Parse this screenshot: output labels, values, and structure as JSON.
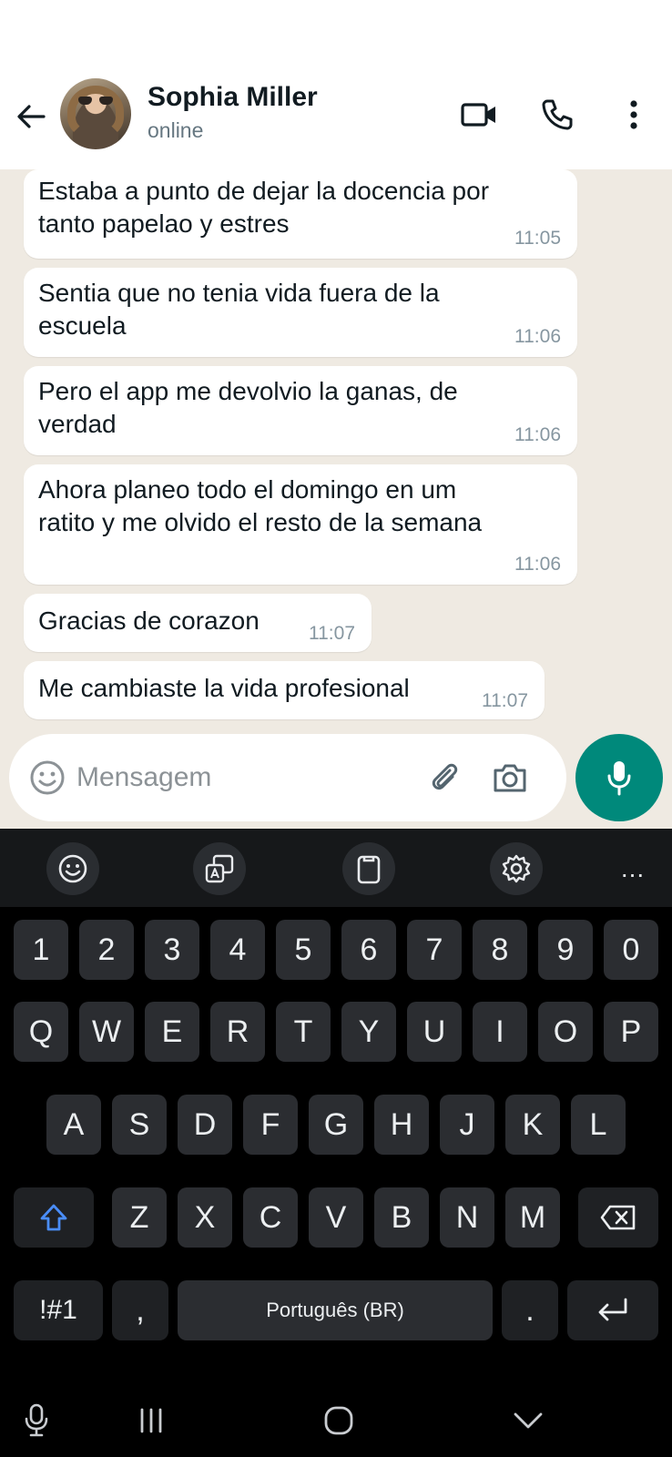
{
  "header": {
    "contact_name": "Sophia Miller",
    "contact_status": "online"
  },
  "messages": [
    {
      "text": "Estaba a punto de dejar la docencia por\ntanto papelao y estres",
      "time": "11:05"
    },
    {
      "text": "Sentia que no tenia vida fuera de la\nescuela",
      "time": "11:06"
    },
    {
      "text": "Pero el app me devolvio la ganas, de\nverdad",
      "time": "11:06"
    },
    {
      "text": "Ahora planeo todo el domingo en um\nratito y me olvido el resto de la semana",
      "time": "11:06"
    },
    {
      "text": "Gracias de corazon",
      "time": "11:07"
    },
    {
      "text": "Me cambiaste la vida profesional",
      "time": "11:07"
    }
  ],
  "composer": {
    "placeholder": "Mensagem",
    "value": ""
  },
  "keyboard": {
    "number_row": [
      "1",
      "2",
      "3",
      "4",
      "5",
      "6",
      "7",
      "8",
      "9",
      "0"
    ],
    "row1": [
      "Q",
      "W",
      "E",
      "R",
      "T",
      "Y",
      "U",
      "I",
      "O",
      "P"
    ],
    "row2": [
      "A",
      "S",
      "D",
      "F",
      "G",
      "H",
      "J",
      "K",
      "L"
    ],
    "row3": [
      "Z",
      "X",
      "C",
      "V",
      "B",
      "N",
      "M"
    ],
    "symbols_label": "!#1",
    "comma_label": ",",
    "space_label": "Português (BR)",
    "period_label": ".",
    "more_label": "..."
  },
  "colors": {
    "accent": "#00897b",
    "chat_background": "#efeae2",
    "bubble": "#ffffff",
    "shift_active": "#4a8df8"
  },
  "icons": {
    "back": "arrow-left-icon",
    "video": "video-call-icon",
    "call": "phone-icon",
    "menu": "more-vertical-icon",
    "emoji": "emoji-icon",
    "attach": "paperclip-icon",
    "camera": "camera-icon",
    "mic": "microphone-icon"
  }
}
